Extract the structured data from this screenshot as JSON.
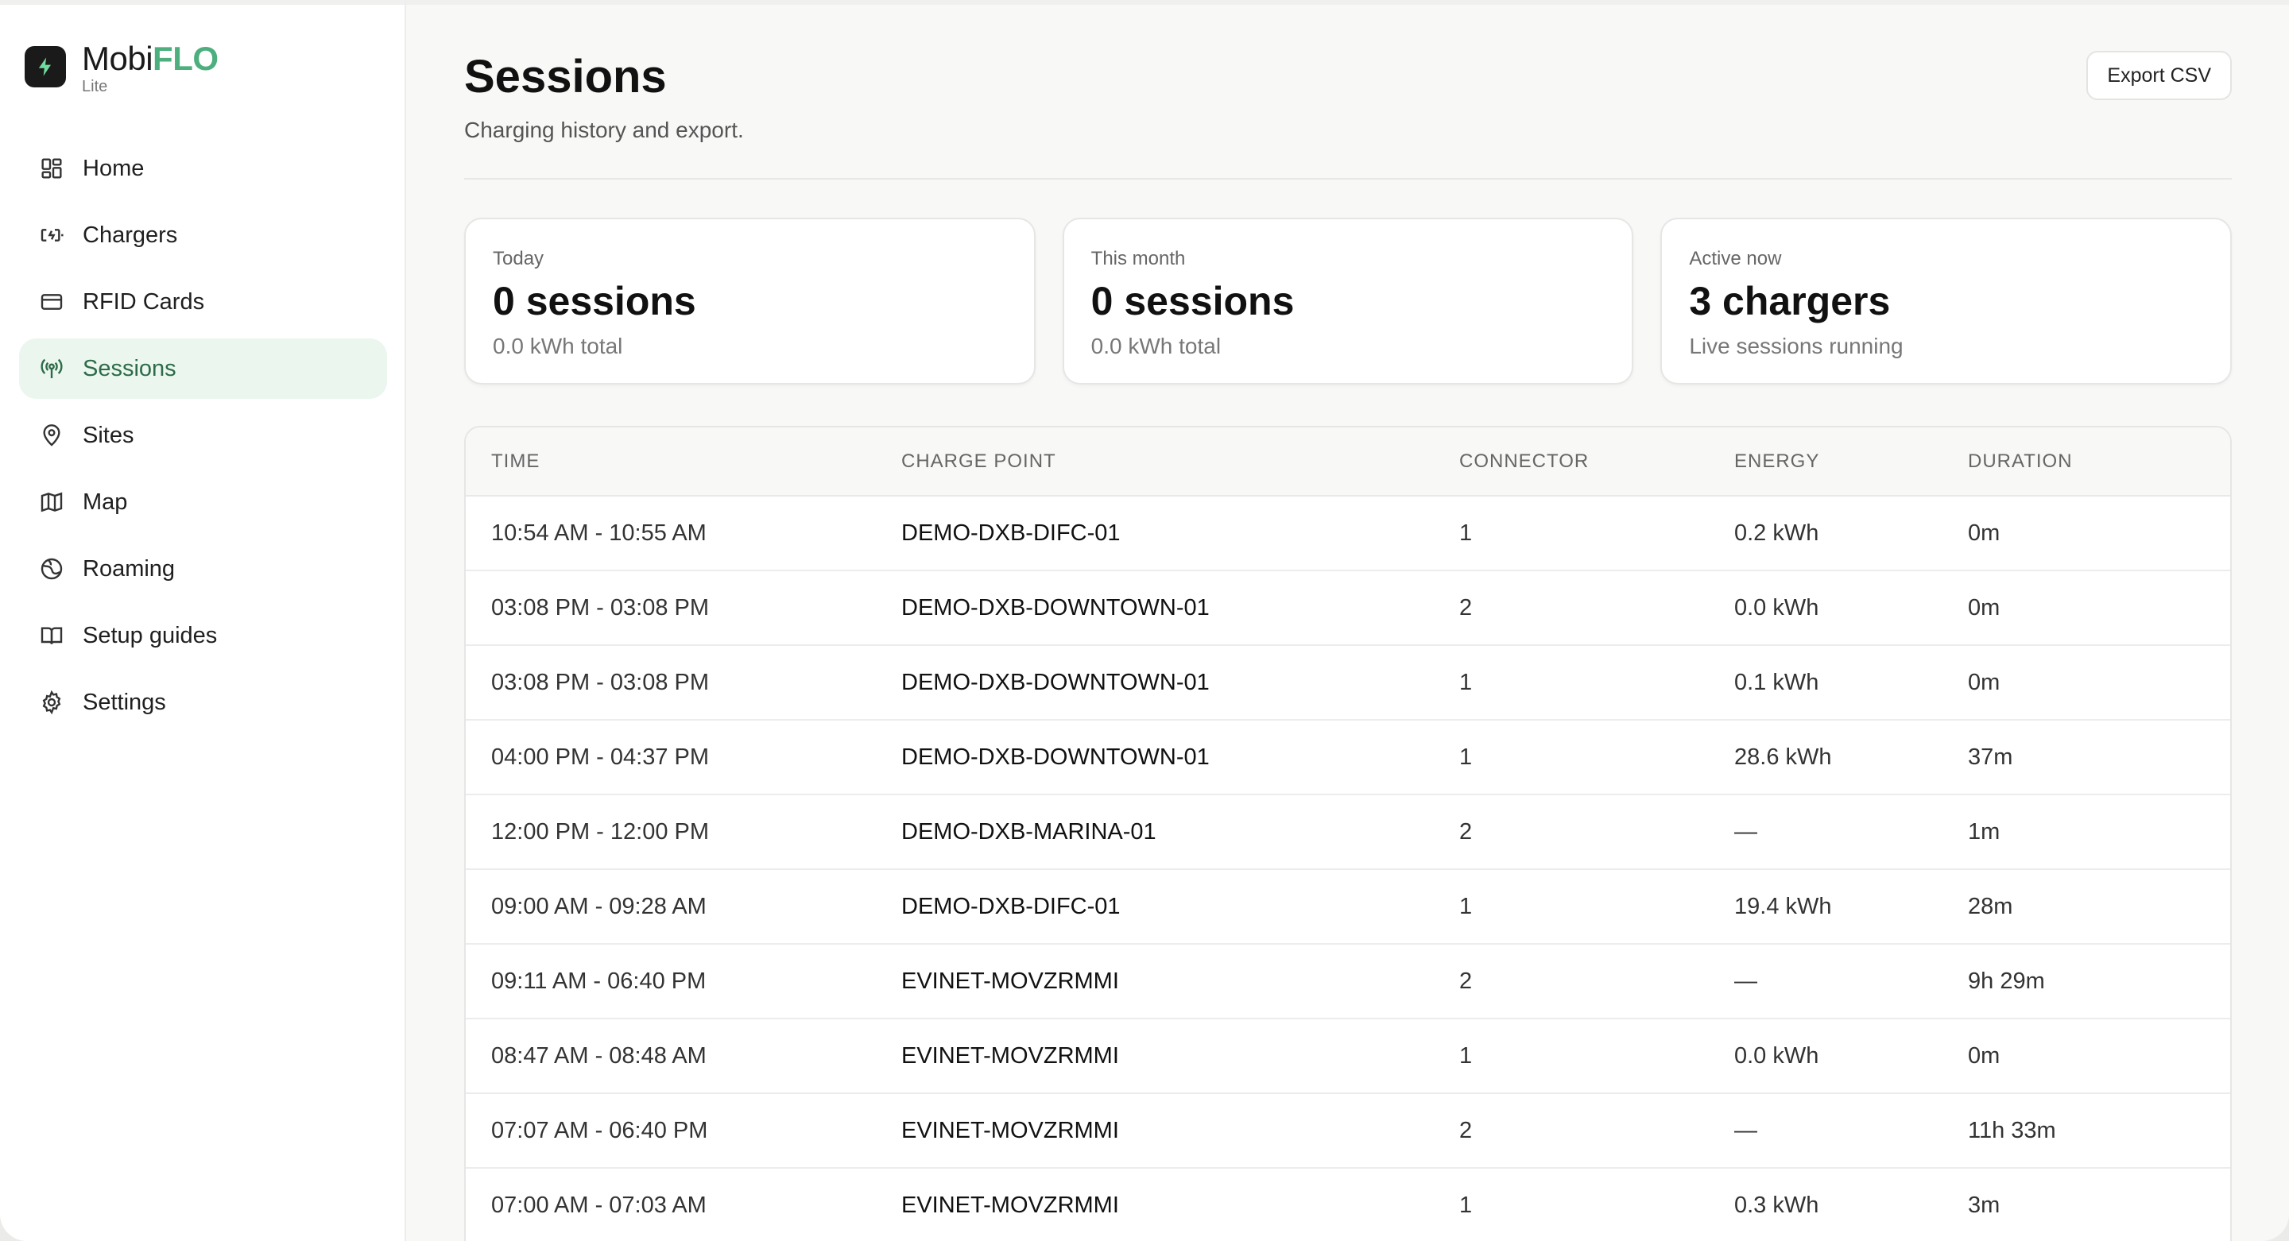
{
  "brand": {
    "name_main": "Mobi",
    "name_accent": "FLO",
    "edition": "Lite",
    "accent_color": "#4caf7d"
  },
  "nav": {
    "items": [
      {
        "label": "Home",
        "icon": "dashboard-icon"
      },
      {
        "label": "Chargers",
        "icon": "battery-charging-icon"
      },
      {
        "label": "RFID Cards",
        "icon": "card-icon"
      },
      {
        "label": "Sessions",
        "icon": "broadcast-icon",
        "active": true
      },
      {
        "label": "Sites",
        "icon": "map-pin-icon"
      },
      {
        "label": "Map",
        "icon": "map-icon"
      },
      {
        "label": "Roaming",
        "icon": "globe-icon"
      },
      {
        "label": "Setup guides",
        "icon": "book-icon"
      },
      {
        "label": "Settings",
        "icon": "gear-icon"
      }
    ]
  },
  "header": {
    "title": "Sessions",
    "subtitle": "Charging history and export.",
    "export_label": "Export CSV"
  },
  "stats": [
    {
      "label": "Today",
      "value": "0 sessions",
      "note": "0.0 kWh total"
    },
    {
      "label": "This month",
      "value": "0 sessions",
      "note": "0.0 kWh total"
    },
    {
      "label": "Active now",
      "value": "3 chargers",
      "note": "Live sessions running"
    }
  ],
  "table": {
    "columns": [
      "TIME",
      "CHARGE POINT",
      "CONNECTOR",
      "ENERGY",
      "DURATION"
    ],
    "rows": [
      [
        "10:54 AM - 10:55 AM",
        "DEMO-DXB-DIFC-01",
        "1",
        "0.2 kWh",
        "0m"
      ],
      [
        "03:08 PM - 03:08 PM",
        "DEMO-DXB-DOWNTOWN-01",
        "2",
        "0.0 kWh",
        "0m"
      ],
      [
        "03:08 PM - 03:08 PM",
        "DEMO-DXB-DOWNTOWN-01",
        "1",
        "0.1 kWh",
        "0m"
      ],
      [
        "04:00 PM - 04:37 PM",
        "DEMO-DXB-DOWNTOWN-01",
        "1",
        "28.6 kWh",
        "37m"
      ],
      [
        "12:00 PM - 12:00 PM",
        "DEMO-DXB-MARINA-01",
        "2",
        "—",
        "1m"
      ],
      [
        "09:00 AM - 09:28 AM",
        "DEMO-DXB-DIFC-01",
        "1",
        "19.4 kWh",
        "28m"
      ],
      [
        "09:11 AM - 06:40 PM",
        "EVINET-MOVZRMMI",
        "2",
        "—",
        "9h 29m"
      ],
      [
        "08:47 AM - 08:48 AM",
        "EVINET-MOVZRMMI",
        "1",
        "0.0 kWh",
        "0m"
      ],
      [
        "07:07 AM - 06:40 PM",
        "EVINET-MOVZRMMI",
        "2",
        "—",
        "11h 33m"
      ],
      [
        "07:00 AM - 07:03 AM",
        "EVINET-MOVZRMMI",
        "1",
        "0.3 kWh",
        "3m"
      ]
    ]
  }
}
